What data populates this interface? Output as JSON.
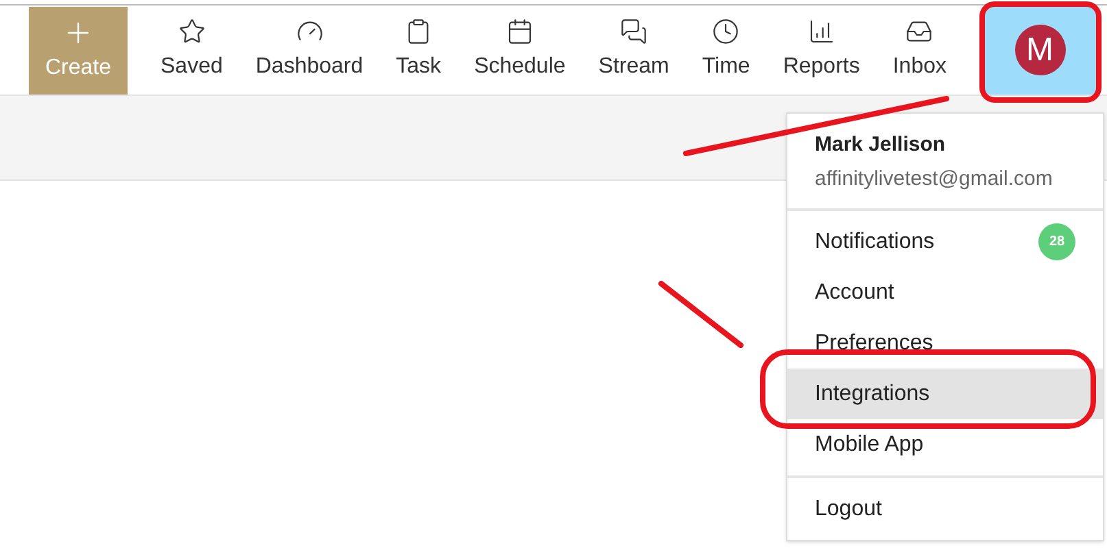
{
  "create_button": {
    "label": "Create"
  },
  "nav": [
    {
      "label": "Saved"
    },
    {
      "label": "Dashboard"
    },
    {
      "label": "Task"
    },
    {
      "label": "Schedule"
    },
    {
      "label": "Stream"
    },
    {
      "label": "Time"
    },
    {
      "label": "Reports"
    },
    {
      "label": "Inbox"
    }
  ],
  "account_button": {
    "initial": "M",
    "selected": true
  },
  "account_menu": {
    "name": "Mark Jellison",
    "email": "affinitylivetest@gmail.com",
    "sections": [
      [
        {
          "label": "Notifications",
          "badge": "28",
          "selected": false
        },
        {
          "label": "Account",
          "selected": false
        },
        {
          "label": "Preferences",
          "selected": false
        },
        {
          "label": "Integrations",
          "selected": true
        },
        {
          "label": "Mobile App",
          "selected": false
        }
      ],
      [
        {
          "label": "Logout",
          "selected": false
        }
      ]
    ]
  }
}
